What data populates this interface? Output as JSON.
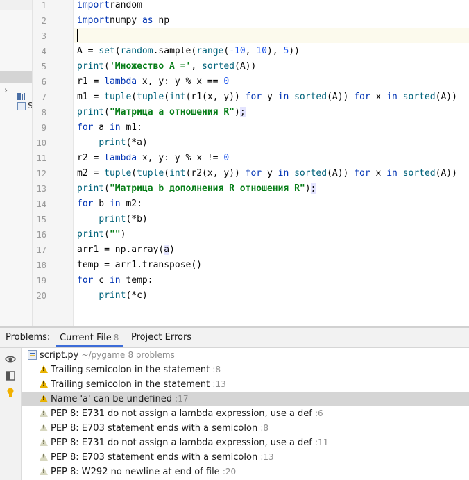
{
  "project_tree": {
    "script_label_fragment": "S"
  },
  "editor": {
    "line_numbers": [
      "1",
      "2",
      "3",
      "4",
      "5",
      "6",
      "7",
      "8",
      "9",
      "10",
      "11",
      "12",
      "13",
      "14",
      "15",
      "16",
      "17",
      "18",
      "19",
      "20"
    ],
    "lines": [
      [
        [
          "kw",
          "import"
        ],
        [
          "",
          "random"
        ]
      ],
      [
        [
          "kw",
          "import"
        ],
        [
          "",
          "numpy "
        ],
        [
          "kw",
          "as"
        ],
        [
          "",
          " np"
        ]
      ],
      [],
      [
        [
          "",
          "A = "
        ],
        [
          "fn",
          "set"
        ],
        [
          "",
          "("
        ],
        [
          "fn",
          "random"
        ],
        [
          "",
          ".sample("
        ],
        [
          "fn",
          "range"
        ],
        [
          "",
          "("
        ],
        [
          "num",
          "-10"
        ],
        [
          "",
          ", "
        ],
        [
          "num",
          "10"
        ],
        [
          "",
          "), "
        ],
        [
          "num",
          "5"
        ],
        [
          "",
          "))"
        ]
      ],
      [
        [
          "fn",
          "print"
        ],
        [
          "",
          "("
        ],
        [
          "str",
          "'Множество А ='"
        ],
        [
          "",
          ", "
        ],
        [
          "fn",
          "sorted"
        ],
        [
          "",
          "(A))"
        ]
      ],
      [
        [
          "",
          "r1 = "
        ],
        [
          "kw",
          "lambda"
        ],
        [
          "",
          " x, y: y % x == "
        ],
        [
          "num",
          "0"
        ]
      ],
      [
        [
          "",
          "m1 = "
        ],
        [
          "fn",
          "tuple"
        ],
        [
          "",
          "("
        ],
        [
          "fn",
          "tuple"
        ],
        [
          "",
          "("
        ],
        [
          "fn",
          "int"
        ],
        [
          "",
          "(r1(x, y)) "
        ],
        [
          "kw",
          "for"
        ],
        [
          "",
          " y "
        ],
        [
          "kw",
          "in"
        ],
        [
          "",
          " "
        ],
        [
          "fn",
          "sorted"
        ],
        [
          "",
          "(A)) "
        ],
        [
          "kw",
          "for"
        ],
        [
          "",
          " x "
        ],
        [
          "kw",
          "in"
        ],
        [
          "",
          " "
        ],
        [
          "fn",
          "sorted"
        ],
        [
          "",
          "(A))"
        ]
      ],
      [
        [
          "fn",
          "print"
        ],
        [
          "",
          "("
        ],
        [
          "str",
          "\"Матрица a отношения R\""
        ],
        [
          "",
          ")"
        ],
        [
          "hl",
          ";"
        ]
      ],
      [
        [
          "kw",
          "for"
        ],
        [
          "",
          " a "
        ],
        [
          "kw",
          "in"
        ],
        [
          "",
          " m1:"
        ]
      ],
      [
        [
          "",
          "    "
        ],
        [
          "fn",
          "print"
        ],
        [
          "",
          "(*a)"
        ]
      ],
      [
        [
          "",
          "r2 = "
        ],
        [
          "kw",
          "lambda"
        ],
        [
          "",
          " x, y: y % x != "
        ],
        [
          "num",
          "0"
        ]
      ],
      [
        [
          "",
          "m2 = "
        ],
        [
          "fn",
          "tuple"
        ],
        [
          "",
          "("
        ],
        [
          "fn",
          "tuple"
        ],
        [
          "",
          "("
        ],
        [
          "fn",
          "int"
        ],
        [
          "",
          "(r2(x, y)) "
        ],
        [
          "kw",
          "for"
        ],
        [
          "",
          " y "
        ],
        [
          "kw",
          "in"
        ],
        [
          "",
          " "
        ],
        [
          "fn",
          "sorted"
        ],
        [
          "",
          "(A)) "
        ],
        [
          "kw",
          "for"
        ],
        [
          "",
          " x "
        ],
        [
          "kw",
          "in"
        ],
        [
          "",
          " "
        ],
        [
          "fn",
          "sorted"
        ],
        [
          "",
          "(A))"
        ]
      ],
      [
        [
          "fn",
          "print"
        ],
        [
          "",
          "("
        ],
        [
          "str",
          "\"Матрица b дополнения R отношения R\""
        ],
        [
          "",
          ")"
        ],
        [
          "hl",
          ";"
        ]
      ],
      [
        [
          "kw",
          "for"
        ],
        [
          "",
          " b "
        ],
        [
          "kw",
          "in"
        ],
        [
          "",
          " m2:"
        ]
      ],
      [
        [
          "",
          "    "
        ],
        [
          "fn",
          "print"
        ],
        [
          "",
          "(*b)"
        ]
      ],
      [
        [
          "fn",
          "print"
        ],
        [
          "",
          "("
        ],
        [
          "str",
          "\"\""
        ],
        [
          "",
          ")"
        ]
      ],
      [
        [
          "",
          "arr1 = np.array("
        ],
        [
          "hl",
          "a"
        ],
        [
          "",
          ")"
        ]
      ],
      [
        [
          "",
          "temp = arr1.transpose()"
        ]
      ],
      [
        [
          "kw",
          "for"
        ],
        [
          "",
          " c "
        ],
        [
          "kw",
          "in"
        ],
        [
          "",
          " temp:"
        ]
      ],
      [
        [
          "",
          "    "
        ],
        [
          "fn",
          "print"
        ],
        [
          "",
          "(*c)"
        ]
      ]
    ]
  },
  "problems": {
    "title": "Problems:",
    "tabs": [
      {
        "label": "Current File",
        "count": "8"
      },
      {
        "label": "Project Errors",
        "count": ""
      }
    ],
    "file": {
      "name": "script.py",
      "path": "~/pygame",
      "summary": "8 problems"
    },
    "items": [
      {
        "text": "Trailing semicolon in the statement",
        "loc": ":8",
        "severity": "warning"
      },
      {
        "text": "Trailing semicolon in the statement",
        "loc": ":13",
        "severity": "warning"
      },
      {
        "text": "Name 'a' can be undefined",
        "loc": ":17",
        "severity": "warning"
      },
      {
        "text": "PEP 8: E731 do not assign a lambda expression, use a def",
        "loc": ":6",
        "severity": "weak"
      },
      {
        "text": "PEP 8: E703 statement ends with a semicolon",
        "loc": ":8",
        "severity": "weak"
      },
      {
        "text": "PEP 8: E731 do not assign a lambda expression, use a def",
        "loc": ":11",
        "severity": "weak"
      },
      {
        "text": "PEP 8: E703 statement ends with a semicolon",
        "loc": ":13",
        "severity": "weak"
      },
      {
        "text": "PEP 8: W292 no newline at end of file",
        "loc": ":20",
        "severity": "weak"
      }
    ]
  },
  "colors": {
    "accent": "#3c6cd8",
    "warning": "#e8b200"
  }
}
